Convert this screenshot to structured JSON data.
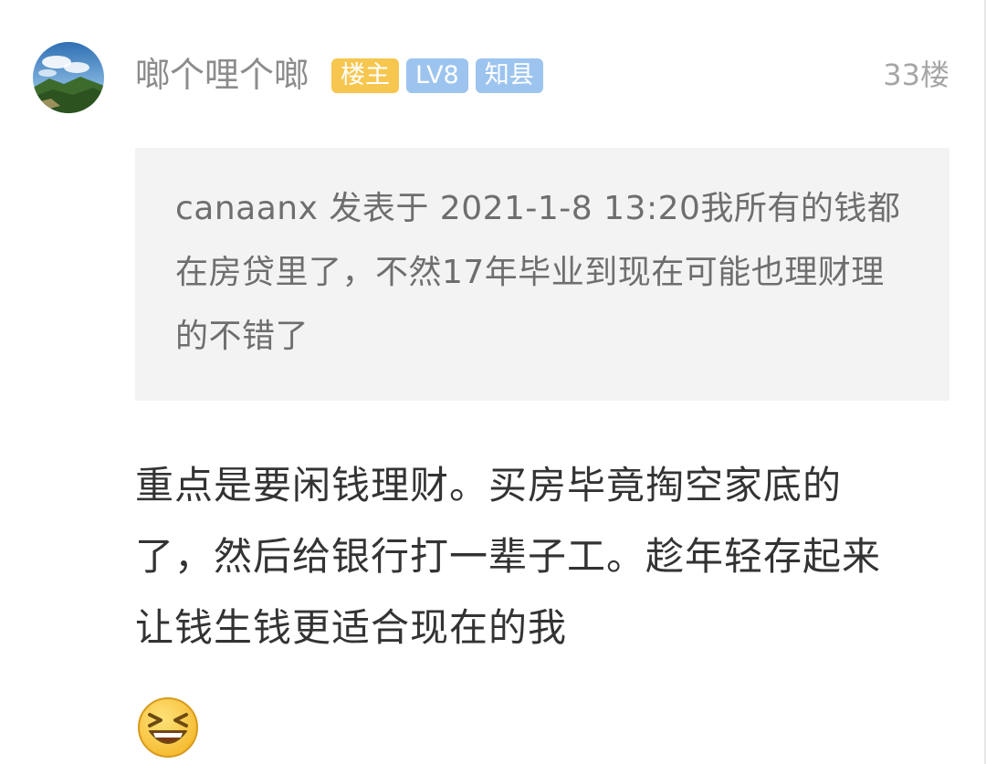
{
  "post": {
    "username": "啷个哩个啷",
    "badges": {
      "owner": "楼主",
      "level": "LV8",
      "title": "知县"
    },
    "floor": "33楼",
    "quote_text": "canaanx 发表于 2021-1-8 13:20我所有的钱都在房贷里了，不然17年毕业到现在可能也理财理的不错了",
    "body_text": "重点是要闲钱理财。买房毕竟掏空家底的了，然后给银行打一辈子工。趁年轻存起来让钱生钱更适合现在的我",
    "emoji": "laughing-squint-emoji",
    "avatar": "landscape-avatar"
  },
  "colors": {
    "owner_badge": "#f7c64f",
    "level_badge": "#9cc4ef",
    "title_badge": "#9cc4ef",
    "quote_background": "#f3f3f3",
    "username": "#8c8c8c"
  }
}
